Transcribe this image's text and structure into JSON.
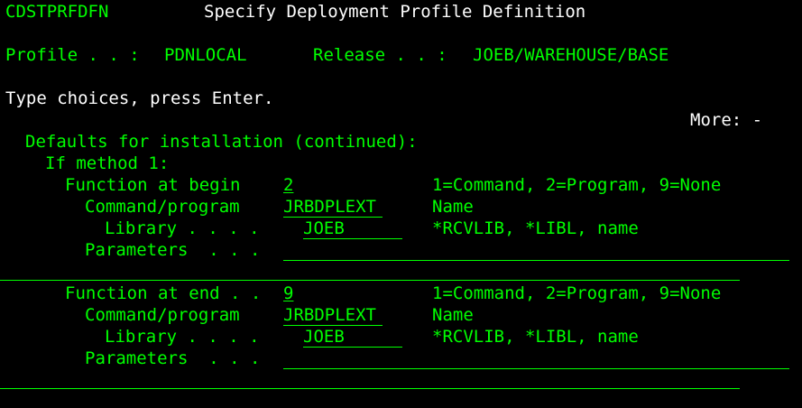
{
  "header": {
    "program_name": "CDSTPRFDFN",
    "title": "Specify Deployment Profile Definition"
  },
  "info": {
    "profile_label": "Profile . . :",
    "profile_value": "PDNLOCAL",
    "release_label": "Release . . :",
    "release_value": "JOEB/WAREHOUSE/BASE"
  },
  "instruction": "Type choices, press Enter.",
  "more_indicator": "More: -",
  "section": {
    "title": "Defaults for installation (continued):",
    "method_label": "If method 1:",
    "begin": {
      "function_label": "Function at begin",
      "function_value": "2",
      "function_hint": "1=Command, 2=Program, 9=None",
      "command_label": "Command/program",
      "command_value": "JRBDPLEXT",
      "command_hint": "Name",
      "library_label": "Library . . . .",
      "library_value": "JOEB",
      "library_hint": "*RCVLIB, *LIBL, name",
      "parameters_label": "Parameters  . . .",
      "parameters_value": ""
    },
    "end": {
      "function_label": "Function at end . .",
      "function_value": "9",
      "function_hint": "1=Command, 2=Program, 9=None",
      "command_label": "Command/program",
      "command_value": "JRBDPLEXT",
      "command_hint": "Name",
      "library_label": "Library . . . .",
      "library_value": "JOEB",
      "library_hint": "*RCVLIB, *LIBL, name",
      "parameters_label": "Parameters  . . .",
      "parameters_value": ""
    }
  },
  "colors": {
    "foreground_green": "#00ff00",
    "foreground_white": "#ffffff",
    "background": "#000000"
  }
}
